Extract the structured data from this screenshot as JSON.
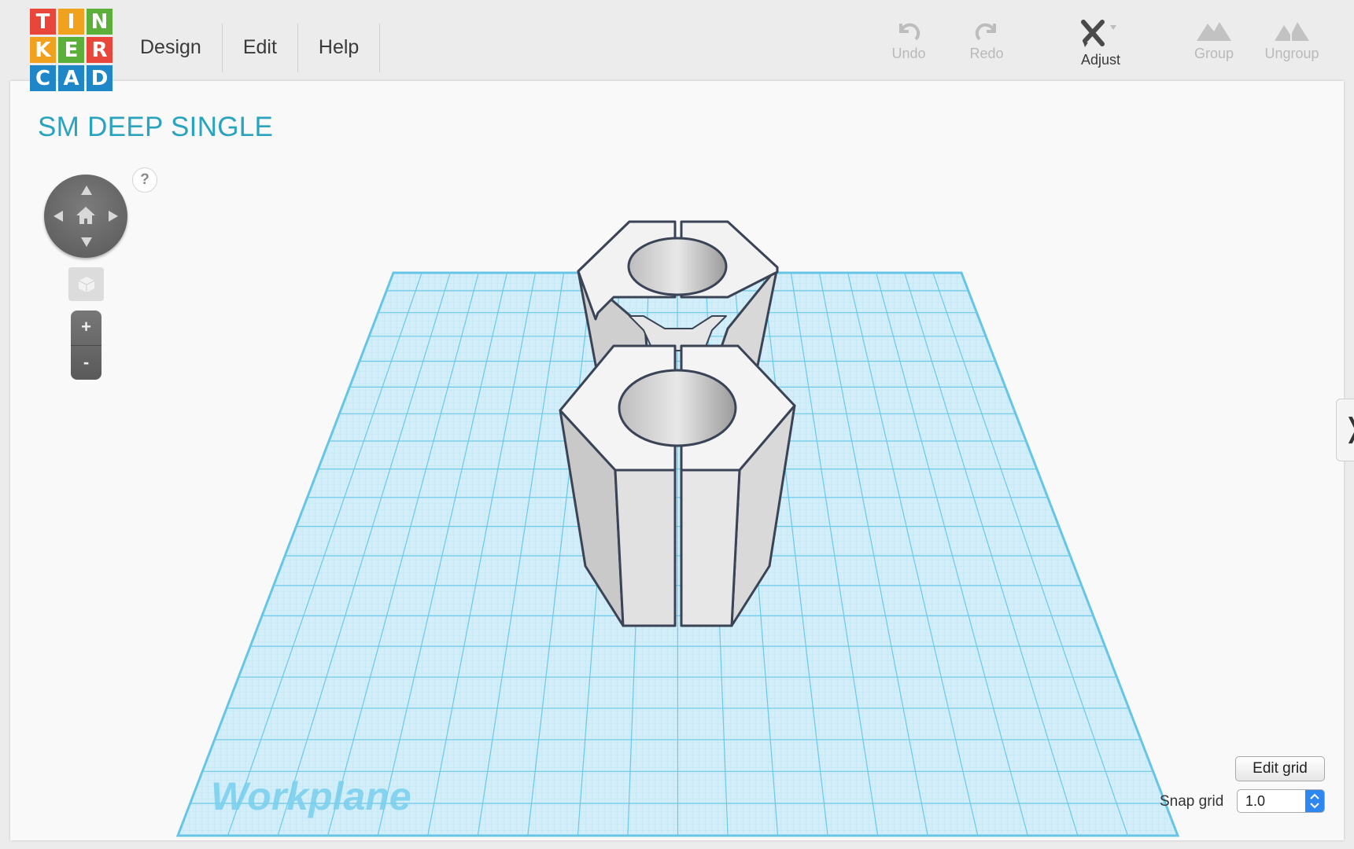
{
  "logo": {
    "letters": [
      "T",
      "I",
      "N",
      "K",
      "E",
      "R",
      "C",
      "A",
      "D"
    ],
    "colors": [
      "#e8463a",
      "#f0a21f",
      "#5cb039",
      "#f0a21f",
      "#5cb039",
      "#e8463a",
      "#1f86c7",
      "#1f86c7",
      "#1f86c7"
    ]
  },
  "menu": {
    "items": [
      {
        "label": "Design"
      },
      {
        "label": "Edit"
      },
      {
        "label": "Help"
      }
    ]
  },
  "toolbar": {
    "undo_label": "Undo",
    "redo_label": "Redo",
    "adjust_label": "Adjust",
    "group_label": "Group",
    "ungroup_label": "Ungroup"
  },
  "design": {
    "title": "SM DEEP SINGLE"
  },
  "navigation": {
    "help_label": "?",
    "zoom_in_label": "+",
    "zoom_out_label": "-"
  },
  "side_panel": {
    "toggle_label": "❭"
  },
  "workplane": {
    "label": "Workplane"
  },
  "grid": {
    "edit_grid_label": "Edit grid",
    "snap_grid_label": "Snap grid",
    "snap_grid_value": "1.0"
  },
  "colors": {
    "accent": "#2aa3bf",
    "grid_fill": "#cbeaf4",
    "grid_line": "#5ec2e6",
    "shape_fill": "#e4e4e4",
    "shape_stroke": "#3b4356"
  }
}
